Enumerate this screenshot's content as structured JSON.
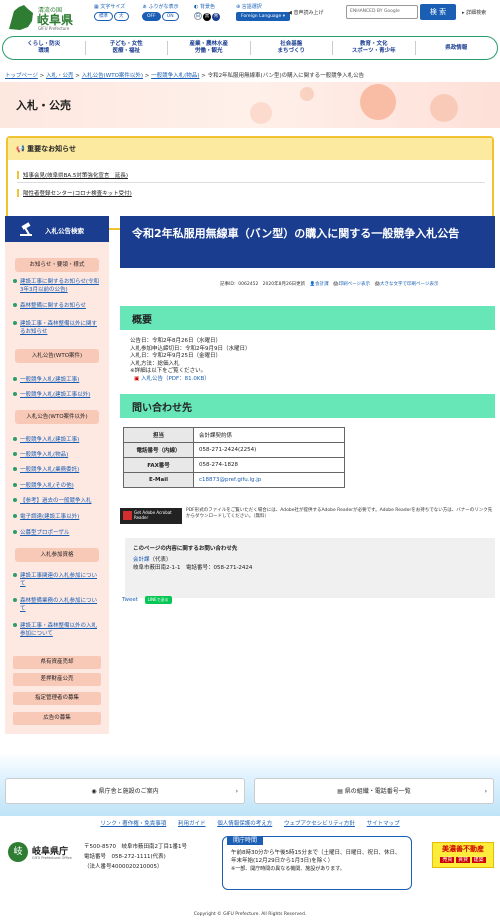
{
  "header": {
    "logo_small": "清流の国",
    "logo_main": "岐阜県",
    "logo_en": "GIFU Prefecture",
    "text_size_label": "文字サイズ",
    "text_size_std": "標準",
    "text_size_large": "大",
    "furigana_label": "ふりがな表示",
    "furigana_off": "OFF",
    "furigana_on": "ON",
    "bgcolor_label": "背景色",
    "bg_white": "白",
    "bg_black": "黒",
    "bg_blue": "青",
    "lang_label": "言語選択",
    "lang_btn": "Foreign Language",
    "audio_label": "音声読み上げ",
    "search_placeholder": "ENHANCED BY Google",
    "search_button": "検 索",
    "detail_search": "詳細検索"
  },
  "gnav": [
    "くらし・防災\n環境",
    "子ども・女性\n医療・福祉",
    "産業・農林水産\n労働・観光",
    "社会基盤\nまちづくり",
    "教育・文化\nスポーツ・青少年",
    "県政情報"
  ],
  "breadcrumb": [
    "トップページ",
    "入札・公売",
    "入札公告(WTO案件以外)",
    "一般競争入札(物品)",
    "令和2年私服用無線車(バン型)の購入に関する一般競争入札公告"
  ],
  "banner_title": "入札・公売",
  "notice": {
    "heading": "重要なお知らせ",
    "items": [
      "知事会見(岐阜県BA.5対策強化宣言　延長)",
      "陽性者登録センター(コロナ検査キット受付)"
    ]
  },
  "sidebar": {
    "title": "入札公告検索",
    "sections": [
      {
        "label": "お知らせ・要領・様式",
        "links": [
          "建設工事に関するお知らせ(令和3年3月以前の公告)",
          "森林整備に関するお知らせ",
          "建設工事・森林整備以外に関するお知らせ"
        ]
      },
      {
        "label": "入札公告(WTO案件)",
        "links": [
          "一般競争入札(建設工事)",
          "一般競争入札(建設工事以外)"
        ]
      },
      {
        "label": "入札公告(WTO案件以外)",
        "links": [
          "一般競争入札(建設工事)",
          "一般競争入札(物品)",
          "一般競争入札(業務委託)",
          "一般競争入札(その他)",
          "【参考】過去の一般競争入札",
          "電子調達(建設工事以外)",
          "公募型プロポーザル"
        ]
      },
      {
        "label": "入札参加資格",
        "links": [
          "建設工事関連の入札参加について",
          "森林整備業務の入札参加について",
          "建設工事・森林整備以外の入札参加について"
        ]
      }
    ],
    "buttons": [
      "県有資産売却",
      "差押財産公売",
      "指定管理者の募集",
      "広告の募集"
    ]
  },
  "page": {
    "title": "令和2年私服用無線車（バン型）の購入に関する一般競争入札公告",
    "meta_id": "記事ID：0062452",
    "meta_date": "2020年8月26日更新",
    "meta_dept": "会計課",
    "meta_print": "印刷ページ表示",
    "meta_large": "大きな文字で印刷ページ表示",
    "overview_heading": "概要",
    "overview_lines": [
      "公告日：令和2年8月26日（水曜日）",
      "入札参加申込締切日：令和2年9月9日（水曜日）",
      "入札日：令和2年9月25日（金曜日）",
      "入札方法：総価入札",
      "※詳細は以下をご覧ください。"
    ],
    "pdf_link": "入札公告（PDF：81.0KB）",
    "inquiry_heading": "問い合わせ先",
    "inquiry_table": [
      [
        "担当",
        "会計課契約係"
      ],
      [
        "電話番号（内線）",
        "058-271-2424(2254)"
      ],
      [
        "FAX番号",
        "058-274-1828"
      ],
      [
        "E-Mail",
        "c18873@pref.gifu.lg.jp"
      ]
    ],
    "adobe_badge": "Get Adobe Acrobat Reader",
    "pdf_note": "PDF形式のファイルをご覧いただく場合には、Adobe社が提供するAdobe Readerが必要です。Adobe Readerをお持ちでない方は、バナーのリンク先からダウンロードしてください。（無料）",
    "contact_heading": "このページの内容に関するお問い合わせ先",
    "contact_dept": "会計課",
    "contact_role": "（代表）",
    "contact_addr": "岐阜市薮田南2-1-1　電話番号：058-271-2424",
    "tweet": "Tweet",
    "line": "LINEで送る"
  },
  "footer": {
    "btn1": "県庁舎と施設のご案内",
    "btn2": "県の組織・電話番号一覧",
    "links": [
      "リンク・著作権・免責事項",
      "利用ガイド",
      "個人情報保護の考え方",
      "ウェブアクセシビリティ方針",
      "サイトマップ"
    ],
    "org": "岐阜県庁",
    "org_en": "GIFU Prefectural Office",
    "address": "〒500-8570　岐阜市薮田南2丁目1番1号",
    "phone": "電話番号　058-272-1111(代表)",
    "corp": "（法人番号4000020210005）",
    "hours_title": "開庁時間",
    "hours": "午前8時30分から午後5時15分まで（土曜日、日曜日、祝日、休日、年末年始(12月29日から1月3日)を除く）",
    "hours_note": "※一部、開庁時間の異なる機関、施設があります。",
    "ad_title": "美濃善不動産",
    "ad_items": [
      "売買",
      "賃貸",
      "建築"
    ],
    "copyright": "Copyright © GIFU Prefecture. All Rights Reserved."
  }
}
